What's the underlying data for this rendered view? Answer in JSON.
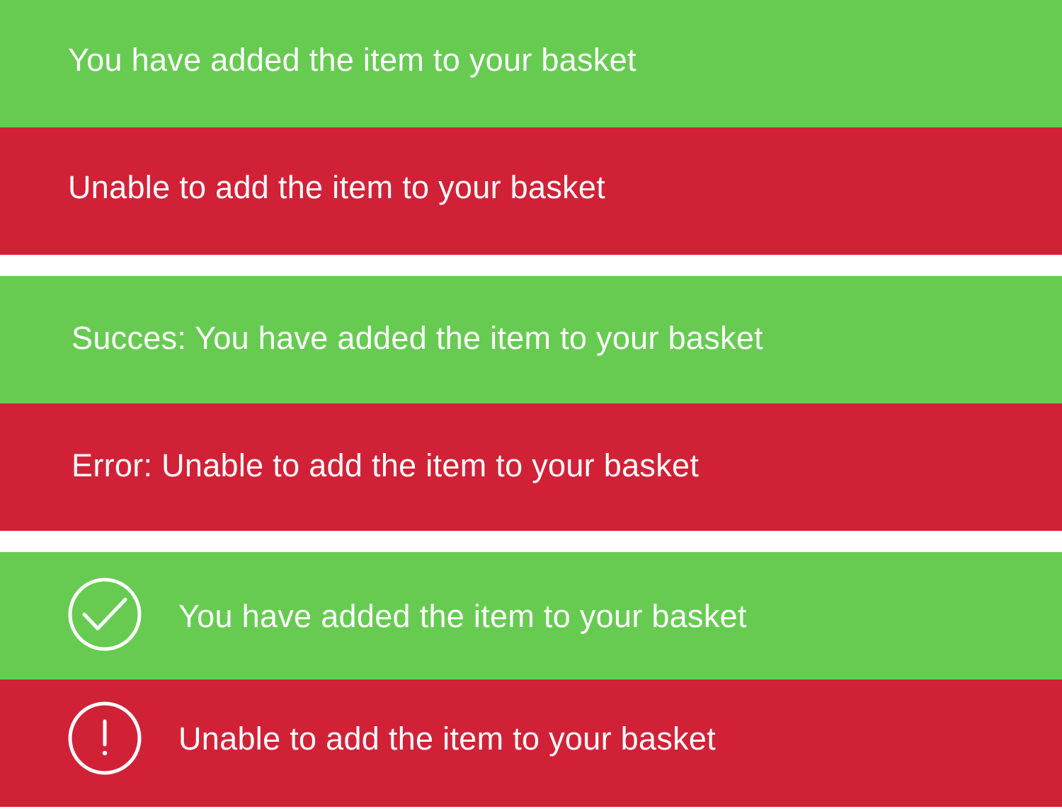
{
  "colors": {
    "success": "#67cb52",
    "error": "#d12137",
    "text": "#ffffff",
    "background": "#ffffff"
  },
  "banners": [
    {
      "variant": "success",
      "text": "You have added the item to your basket"
    },
    {
      "variant": "error",
      "text": "Unable to add the item to your basket"
    },
    {
      "variant": "success",
      "text": "Succes: You have added the item to your basket"
    },
    {
      "variant": "error",
      "text": "Error: Unable to add the item to your basket"
    },
    {
      "variant": "success",
      "icon": "check-circle-icon",
      "text": "You have added the item to your basket"
    },
    {
      "variant": "error",
      "icon": "exclamation-circle-icon",
      "text": "Unable to add the item to your basket"
    }
  ]
}
